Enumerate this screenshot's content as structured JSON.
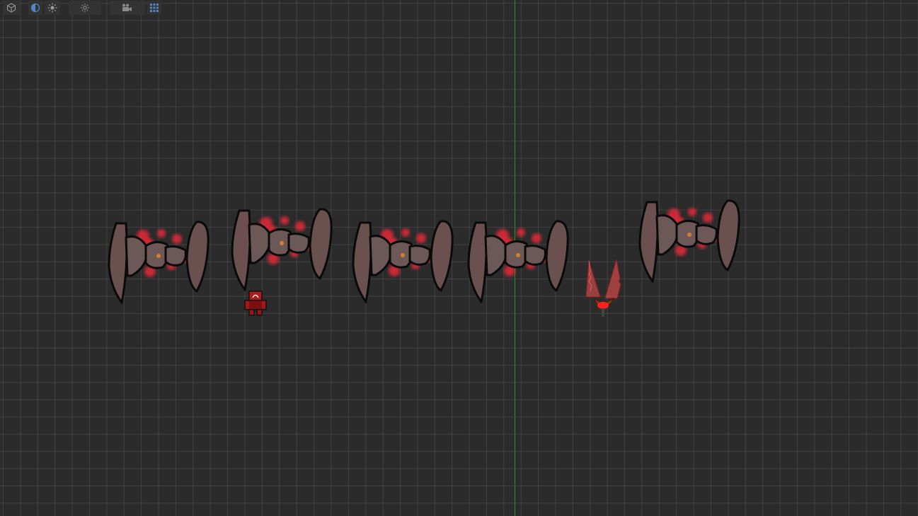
{
  "app": "scene-view",
  "toolbar": {
    "buttons": [
      {
        "id": "view-3d",
        "icon": "cube-icon"
      },
      {
        "id": "render-mode",
        "icon": "half-circle-icon",
        "active": true
      },
      {
        "id": "lighting",
        "icon": "sun-icon"
      },
      {
        "id": "lighting-dropdown",
        "icon": "sun-dropdown-icon"
      },
      {
        "id": "camera",
        "icon": "camera-icon"
      },
      {
        "id": "grid",
        "icon": "grid-icon",
        "active": true
      }
    ]
  },
  "scene": {
    "axis_color": "#1e9a1e",
    "enemy_color": "#6b5050",
    "glow_color": "#ff2a3a",
    "player_color": "#b01c1c",
    "ship_color": "#c84848",
    "entities": [
      {
        "type": "crab-enemy",
        "name": "enemy-1"
      },
      {
        "type": "crab-enemy",
        "name": "enemy-2"
      },
      {
        "type": "crab-enemy",
        "name": "enemy-3"
      },
      {
        "type": "crab-enemy",
        "name": "enemy-4"
      },
      {
        "type": "crab-enemy",
        "name": "enemy-5"
      },
      {
        "type": "player-robot",
        "name": "player"
      },
      {
        "type": "wing-ship",
        "name": "ship"
      }
    ]
  }
}
